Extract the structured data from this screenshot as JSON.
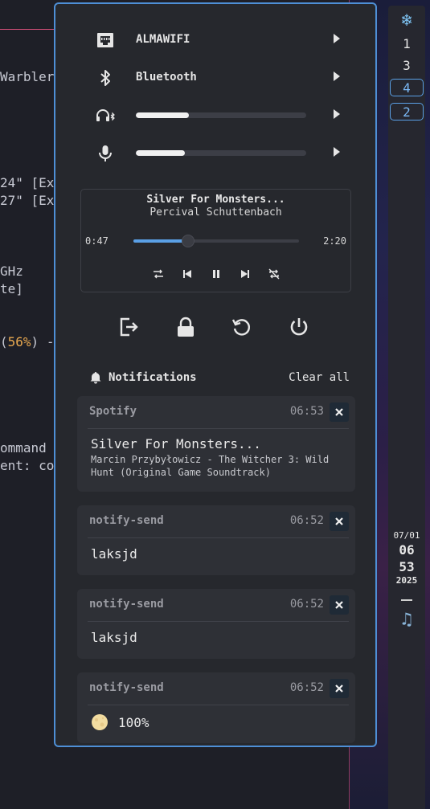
{
  "terminal": {
    "lines": [
      {
        "text": "Warbler"
      },
      {
        "text": "24\" [Ex"
      },
      {
        "text": "27\" [Ex"
      },
      {
        "text": "GHz"
      },
      {
        "text": "te]"
      },
      {
        "pre": "(",
        "hl": "56%",
        "post": ") -"
      },
      {
        "text": "ommand"
      },
      {
        "text": "ent: co"
      }
    ]
  },
  "bar": {
    "top_icon": "snowflake-icon",
    "workspaces": [
      {
        "label": "1",
        "style": "plain"
      },
      {
        "label": "3",
        "style": "plain"
      },
      {
        "label": "4",
        "style": "boxed"
      },
      {
        "label": "2",
        "style": "boxed"
      }
    ],
    "clock": {
      "date": "07/01",
      "hour": "06",
      "minute": "53",
      "year": "2025"
    },
    "tray_icon": "music-note-icon"
  },
  "quick_settings": {
    "wifi": {
      "label": "ALMAWIFI",
      "icon": "ethernet-icon"
    },
    "bluetooth": {
      "label": "Bluetooth",
      "icon": "bluetooth-icon"
    },
    "headphone_volume": {
      "icon": "headphones-bluetooth-icon",
      "level": 0.31
    },
    "mic_volume": {
      "icon": "microphone-icon",
      "level": 0.29
    }
  },
  "media_player": {
    "title": "Silver For Monsters...",
    "artist": "Percival Schuttenbach",
    "current_time": "0:47",
    "total_time": "2:20",
    "progress": 0.33
  },
  "notifications": {
    "header": "Notifications",
    "clear_all": "Clear all",
    "items": [
      {
        "app": "Spotify",
        "time": "06:53",
        "summary": "Silver For Monsters...",
        "body": "Marcin Przybyłowicz - The Witcher 3: Wild Hunt (Original Game Soundtrack)"
      },
      {
        "app": "notify-send",
        "time": "06:52",
        "summary": "laksjd"
      },
      {
        "app": "notify-send",
        "time": "06:52",
        "summary": "laksjd"
      },
      {
        "app": "notify-send",
        "time": "06:52",
        "summary": "100%",
        "icon": "moon-icon"
      }
    ]
  },
  "colors": {
    "accent": "#4e8fd6",
    "panel_bg": "#26282d",
    "card_bg": "#2e3036",
    "highlight_orange": "#e8a850"
  }
}
